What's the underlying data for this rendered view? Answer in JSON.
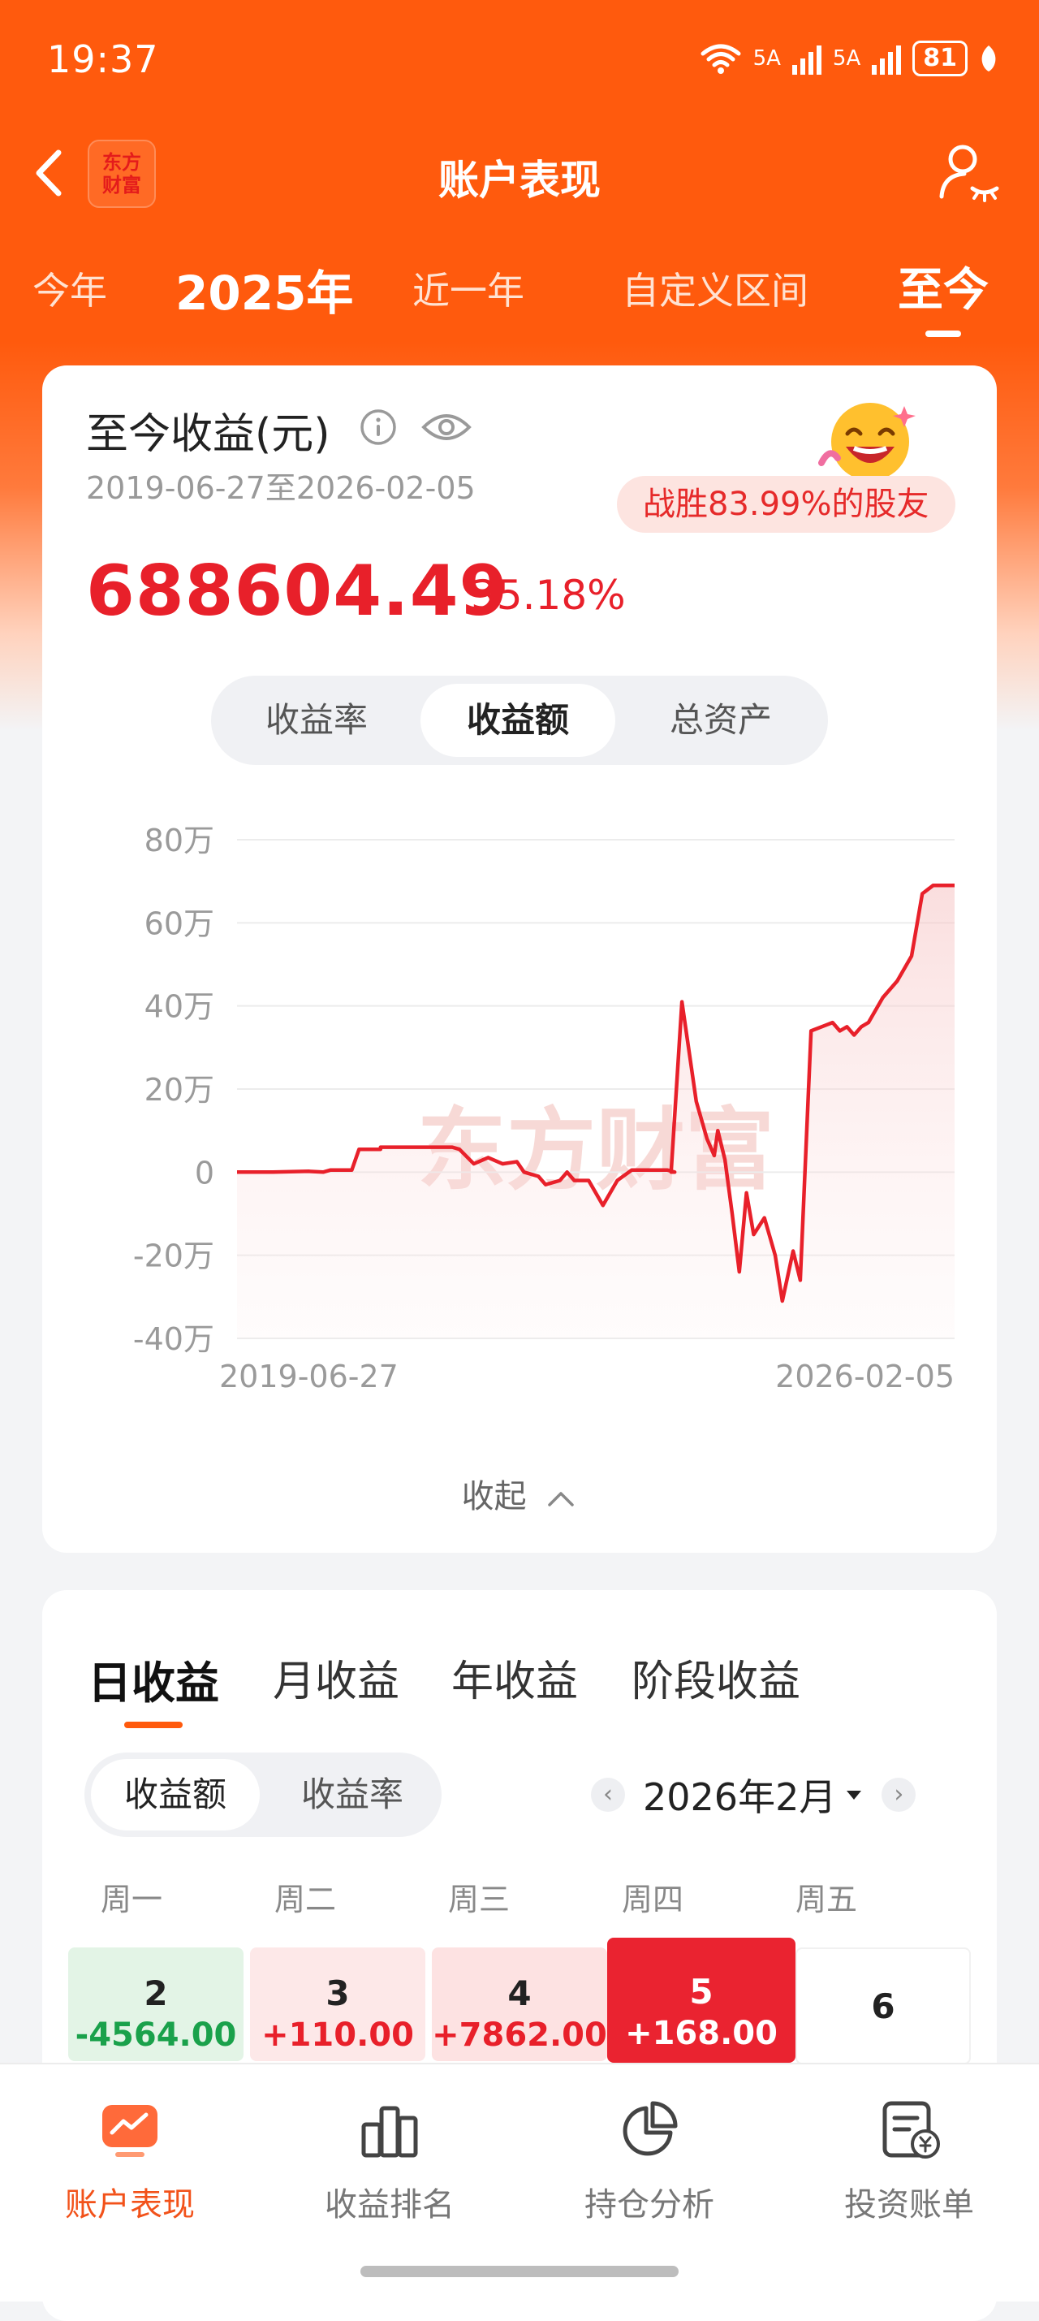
{
  "status": {
    "time": "19:37",
    "signal1": "5A",
    "signal2": "5A",
    "battery": "81"
  },
  "nav": {
    "title": "账户表现",
    "logo": "东方\n财富"
  },
  "periods": [
    {
      "label": "今年"
    },
    {
      "label": "2025年"
    },
    {
      "label": "近一年"
    },
    {
      "label": "自定义区间"
    },
    {
      "label": "至今",
      "active": true
    }
  ],
  "summary": {
    "title": "至今收益(元)",
    "date_range": "2019-06-27至2026-02-05",
    "beat_text": "战胜83.99%的股友",
    "profit": "688604.49",
    "rate": "35.18%"
  },
  "segment": {
    "items": [
      "收益率",
      "收益额",
      "总资产"
    ],
    "selected": "收益额"
  },
  "chart_data": {
    "type": "area",
    "ylabel": "",
    "xlabel": "",
    "ylim": [
      -400000,
      800000
    ],
    "yticks": [
      -400000,
      -200000,
      0,
      200000,
      400000,
      600000,
      800000
    ],
    "ytick_labels": [
      "-40万",
      "-20万",
      "0",
      "20万",
      "40万",
      "60万",
      "80万"
    ],
    "x_start_label": "2019-06-27",
    "x_end_label": "2026-02-05",
    "watermark": "东方财富",
    "grid": true,
    "color": "#e8202a",
    "points": [
      [
        0,
        0
      ],
      [
        0.05,
        0
      ],
      [
        0.1,
        2000
      ],
      [
        0.12,
        0
      ],
      [
        0.13,
        5000
      ],
      [
        0.16,
        5000
      ],
      [
        0.17,
        55000
      ],
      [
        0.2,
        55000
      ],
      [
        0.2,
        60000
      ],
      [
        0.3,
        60000
      ],
      [
        0.31,
        55000
      ],
      [
        0.33,
        20000
      ],
      [
        0.35,
        35000
      ],
      [
        0.37,
        20000
      ],
      [
        0.39,
        25000
      ],
      [
        0.4,
        0
      ],
      [
        0.42,
        -10000
      ],
      [
        0.43,
        -30000
      ],
      [
        0.45,
        -20000
      ],
      [
        0.46,
        0
      ],
      [
        0.47,
        -20000
      ],
      [
        0.49,
        -20000
      ],
      [
        0.51,
        -80000
      ],
      [
        0.53,
        -20000
      ],
      [
        0.55,
        5000
      ],
      [
        0.6,
        5000
      ],
      [
        0.61,
        0
      ],
      [
        0.605,
        0
      ],
      [
        0.62,
        410000
      ],
      [
        0.64,
        170000
      ],
      [
        0.655,
        80000
      ],
      [
        0.665,
        40000
      ],
      [
        0.67,
        100000
      ],
      [
        0.68,
        30000
      ],
      [
        0.69,
        -100000
      ],
      [
        0.7,
        -240000
      ],
      [
        0.71,
        -50000
      ],
      [
        0.72,
        -150000
      ],
      [
        0.735,
        -110000
      ],
      [
        0.75,
        -200000
      ],
      [
        0.76,
        -310000
      ],
      [
        0.775,
        -190000
      ],
      [
        0.785,
        -260000
      ],
      [
        0.8,
        340000
      ],
      [
        0.83,
        360000
      ],
      [
        0.84,
        340000
      ],
      [
        0.85,
        350000
      ],
      [
        0.86,
        330000
      ],
      [
        0.87,
        350000
      ],
      [
        0.88,
        360000
      ],
      [
        0.9,
        420000
      ],
      [
        0.92,
        460000
      ],
      [
        0.94,
        520000
      ],
      [
        0.955,
        670000
      ],
      [
        0.97,
        690000
      ],
      [
        1.0,
        690000
      ]
    ]
  },
  "collapse_label": "收起",
  "daily": {
    "tabs": [
      "日收益",
      "月收益",
      "年收益",
      "阶段收益"
    ],
    "selected_tab": "日收益",
    "mode_items": [
      "收益额",
      "收益率"
    ],
    "mode_selected": "收益额",
    "month_label": "2026年2月",
    "weekdays": [
      "周一",
      "周二",
      "周三",
      "周四",
      "周五"
    ],
    "days": [
      {
        "day": "2",
        "value": "-4564.00",
        "style": "loss"
      },
      {
        "day": "3",
        "value": "+110.00",
        "style": "gain"
      },
      {
        "day": "4",
        "value": "+7862.00",
        "style": "gain"
      },
      {
        "day": "5",
        "value": "+168.00",
        "style": "today"
      },
      {
        "day": "6",
        "value": "",
        "style": "empty"
      }
    ]
  },
  "bottom_nav": [
    {
      "label": "账户表现",
      "icon": "trend-chart-icon",
      "active": true
    },
    {
      "label": "收益排名",
      "icon": "bar-rank-icon"
    },
    {
      "label": "持仓分析",
      "icon": "pie-chart-icon"
    },
    {
      "label": "投资账单",
      "icon": "bill-icon"
    }
  ],
  "colors": {
    "brand": "#ff5a0d",
    "profit_red": "#e8202a",
    "loss_green": "#1aa14b"
  }
}
